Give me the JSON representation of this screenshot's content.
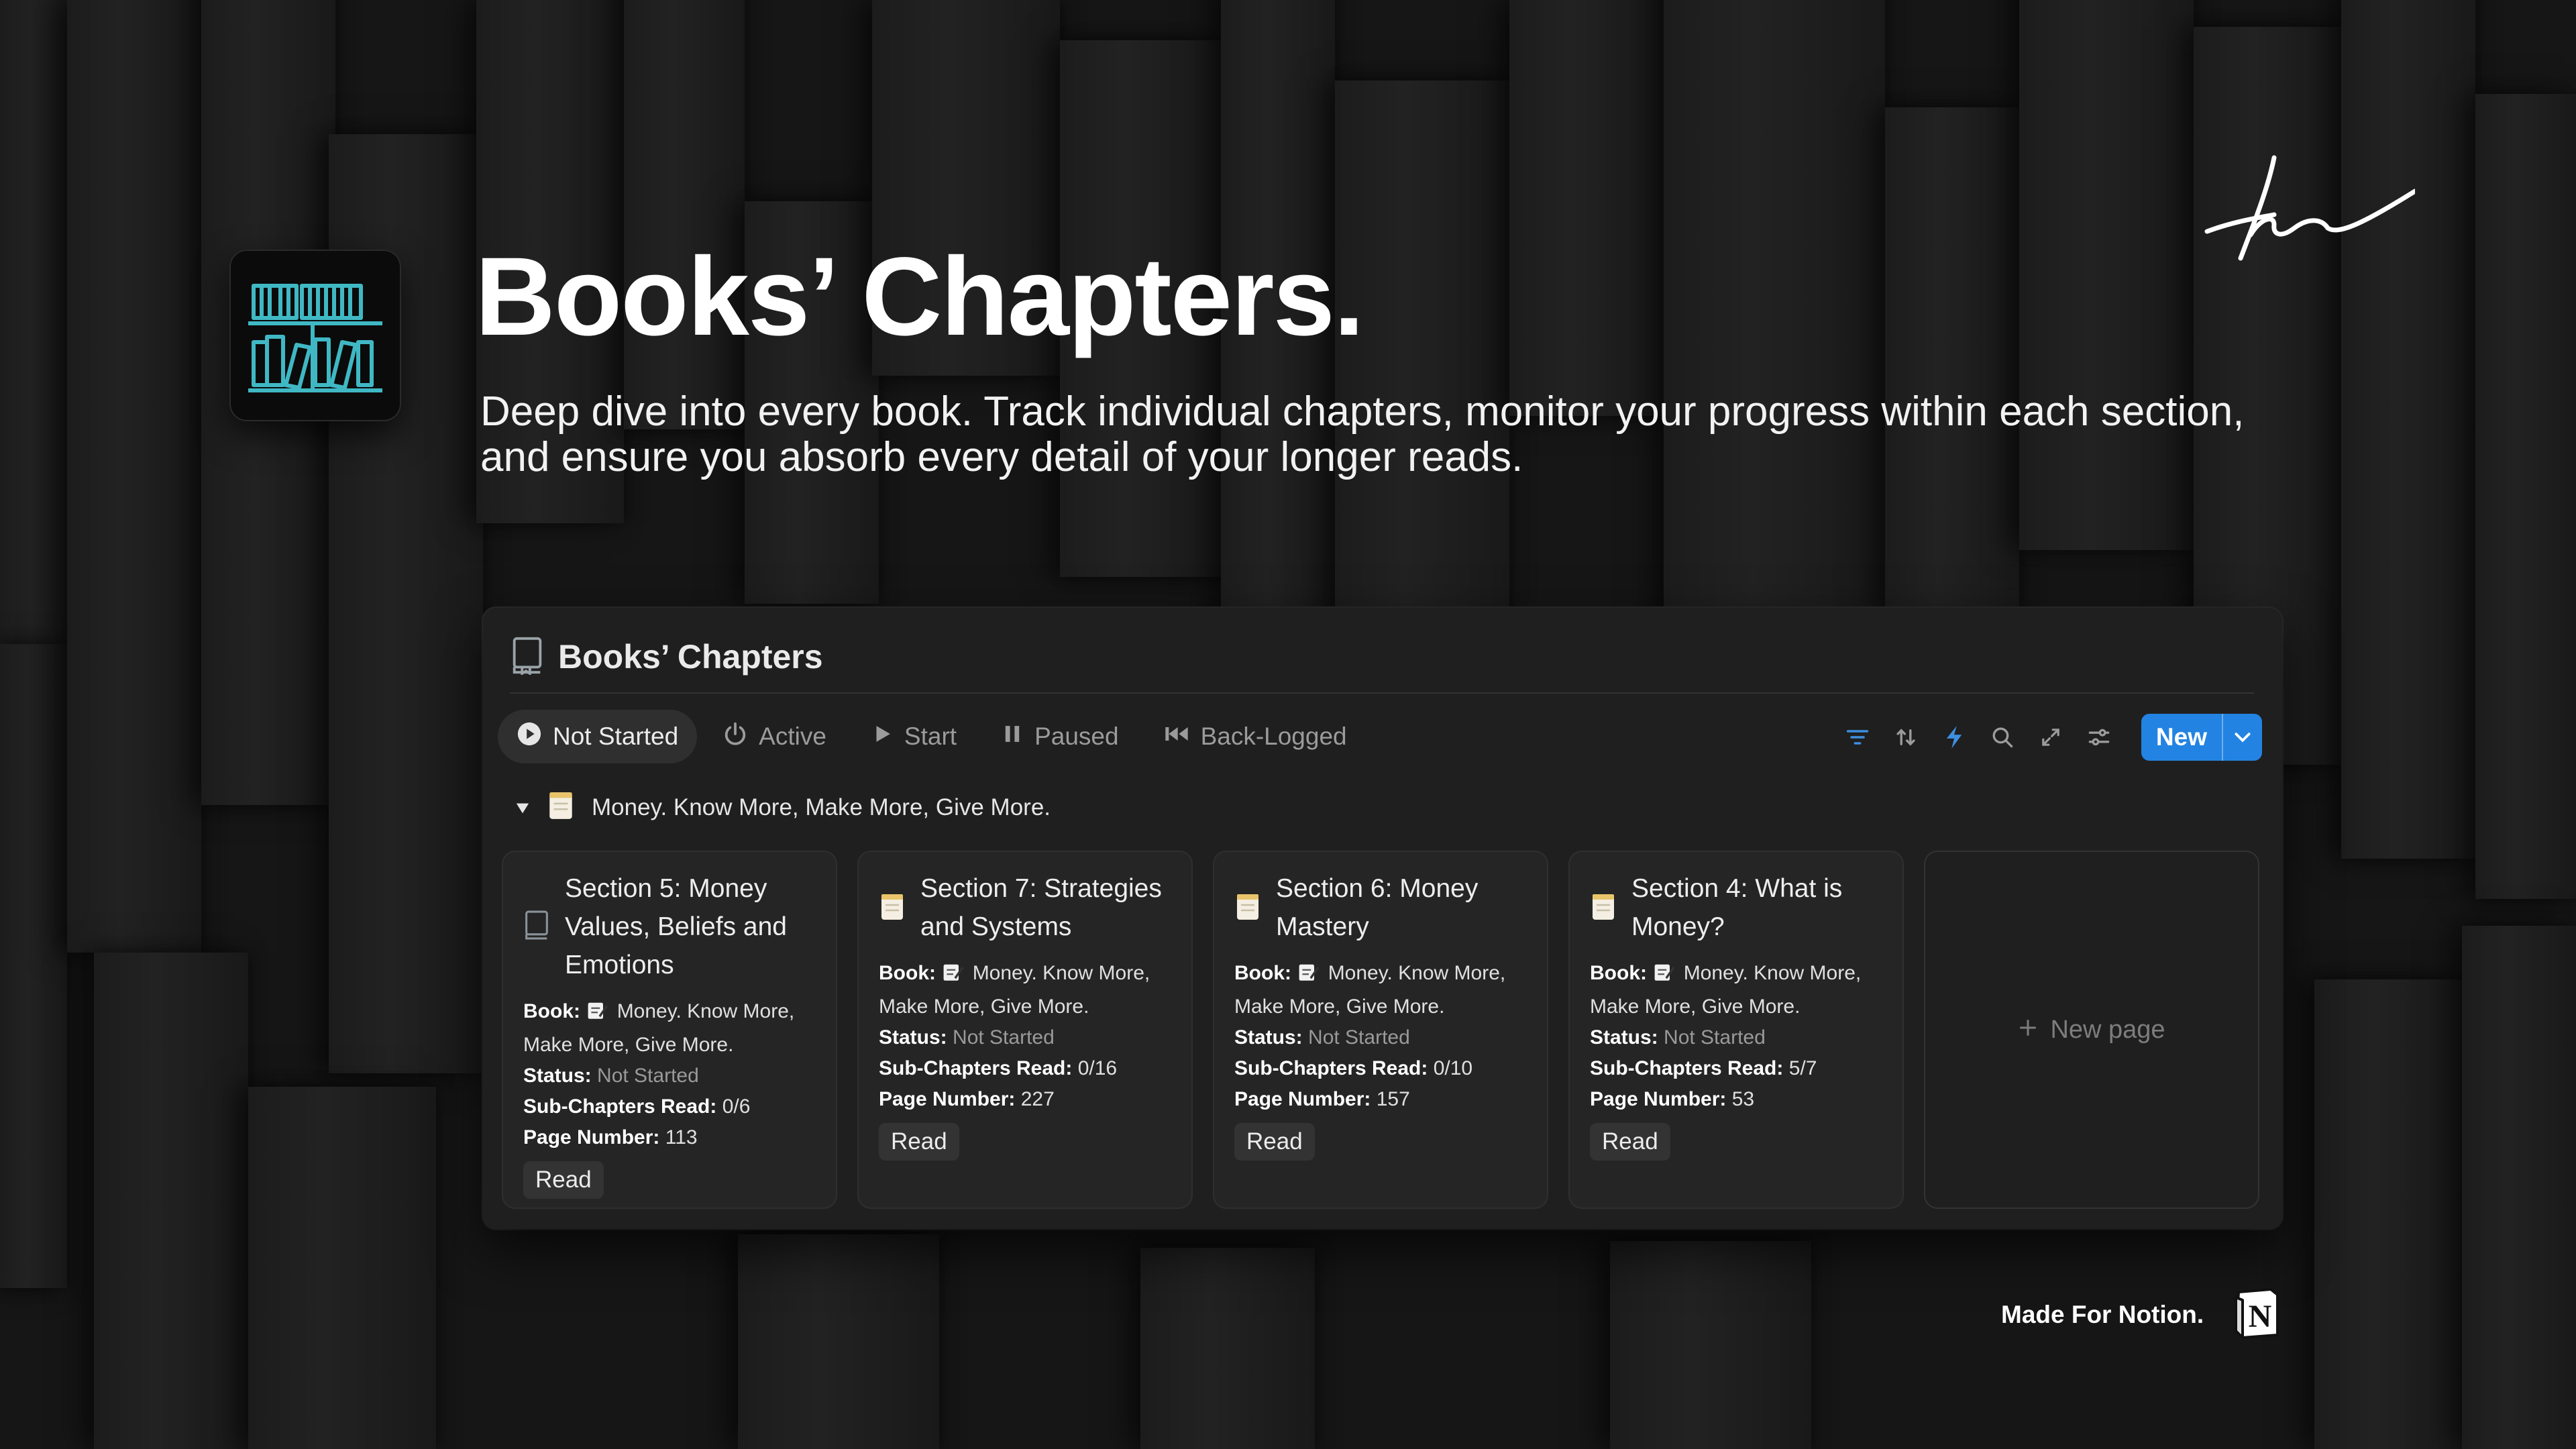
{
  "hero": {
    "title": "Books’ Chapters.",
    "subtitle": "Deep dive into every book. Track individual chapters, monitor your progress within each section, and ensure you absorb every detail of your longer reads."
  },
  "database": {
    "title": "Books’ Chapters",
    "tabs": [
      {
        "label": "Not Started",
        "icon": "play-circle-icon"
      },
      {
        "label": "Active",
        "icon": "power-icon"
      },
      {
        "label": "Start",
        "icon": "play-icon"
      },
      {
        "label": "Paused",
        "icon": "pause-icon"
      },
      {
        "label": "Back-Logged",
        "icon": "skip-back-icon"
      }
    ],
    "toolbar": {
      "new_label": "New"
    },
    "group": {
      "label": "Money. Know More, Make More, Give More."
    },
    "property_labels": {
      "book": "Book:",
      "status": "Status:",
      "subchapters": "Sub-Chapters Read:",
      "page": "Page Number:"
    },
    "cards": [
      {
        "title": "Section 5: Money Values, Beliefs and Emotions",
        "book": "Money. Know More, Make More, Give More.",
        "status": "Not Started",
        "subchapters": "0/6",
        "page": "113",
        "tag": "Read"
      },
      {
        "title": "Section 7: Strategies and Systems",
        "book": "Money. Know More, Make More, Give More.",
        "status": "Not Started",
        "subchapters": "0/16",
        "page": "227",
        "tag": "Read"
      },
      {
        "title": "Section 6: Money Mastery",
        "book": "Money. Know More, Make More, Give More.",
        "status": "Not Started",
        "subchapters": "0/10",
        "page": "157",
        "tag": "Read"
      },
      {
        "title": "Section 4: What is Money?",
        "book": "Money. Know More, Make More, Give More.",
        "status": "Not Started",
        "subchapters": "5/7",
        "page": "53",
        "tag": "Read"
      }
    ],
    "new_page_label": "New page"
  },
  "footer": {
    "made_for": "Made For Notion.",
    "logo_letter": "N"
  },
  "colors": {
    "accent": "#2383e2",
    "icon_teal": "#3fb8c4"
  }
}
